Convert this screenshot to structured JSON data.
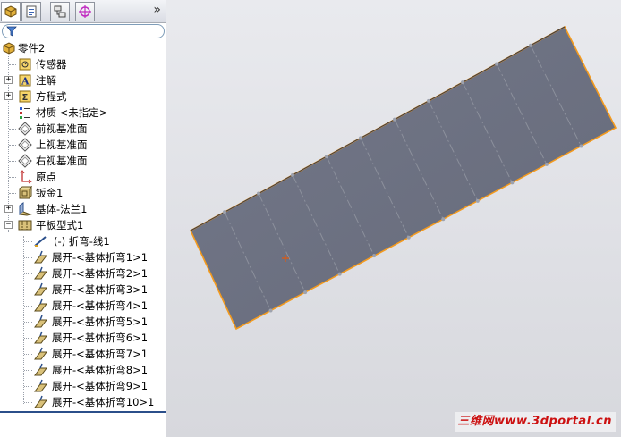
{
  "tabs": [
    {
      "name": "feature-manager",
      "icon": "feature-tree-icon",
      "active": true
    },
    {
      "name": "property-manager",
      "icon": "property-manager-icon",
      "active": false
    },
    {
      "name": "configuration-manager",
      "icon": "configuration-manager-icon",
      "active": false
    },
    {
      "name": "dim-xpert-manager",
      "icon": "dimxpert-crosshair-icon",
      "active": false
    }
  ],
  "more_tabs_label": "»",
  "filter": {
    "placeholder": "",
    "value": ""
  },
  "tree": {
    "root": "零件2",
    "items": [
      {
        "label": "传感器",
        "icon": "sensor-icon"
      },
      {
        "label": "注解",
        "icon": "annotation-icon"
      },
      {
        "label": "方程式",
        "icon": "equation-icon"
      },
      {
        "label": "材质 <未指定>",
        "icon": "material-icon"
      },
      {
        "label": "前视基准面",
        "icon": "plane-icon"
      },
      {
        "label": "上视基准面",
        "icon": "plane-icon"
      },
      {
        "label": "右视基准面",
        "icon": "plane-icon"
      },
      {
        "label": "原点",
        "icon": "origin-icon"
      },
      {
        "label": "钣金1",
        "icon": "sheet-metal-icon"
      },
      {
        "label": "基体-法兰1",
        "icon": "base-flange-icon"
      },
      {
        "label": "平板型式1",
        "icon": "flat-pattern-icon"
      }
    ],
    "flat_children": [
      {
        "label": "(-) 折弯-线1",
        "icon": "bend-line-icon"
      },
      {
        "label": "展开-<基体折弯1>1",
        "icon": "unfold-bend-icon"
      },
      {
        "label": "展开-<基体折弯2>1",
        "icon": "unfold-bend-icon"
      },
      {
        "label": "展开-<基体折弯3>1",
        "icon": "unfold-bend-icon"
      },
      {
        "label": "展开-<基体折弯4>1",
        "icon": "unfold-bend-icon"
      },
      {
        "label": "展开-<基体折弯5>1",
        "icon": "unfold-bend-icon"
      },
      {
        "label": "展开-<基体折弯6>1",
        "icon": "unfold-bend-icon"
      },
      {
        "label": "展开-<基体折弯7>1",
        "icon": "unfold-bend-icon"
      },
      {
        "label": "展开-<基体折弯8>1",
        "icon": "unfold-bend-icon"
      },
      {
        "label": "展开-<基体折弯9>1",
        "icon": "unfold-bend-icon"
      },
      {
        "label": "展开-<基体折弯10>1",
        "icon": "unfold-bend-icon"
      }
    ]
  },
  "watermark": "三维网www.3dportal.cn",
  "colors": {
    "panel_fill": "#6b7080",
    "edge_highlight": "#f39a1e",
    "bend_line": "#8c909c",
    "origin_mark": "#e05a10",
    "graphics_bg": "#e3e4e8"
  }
}
